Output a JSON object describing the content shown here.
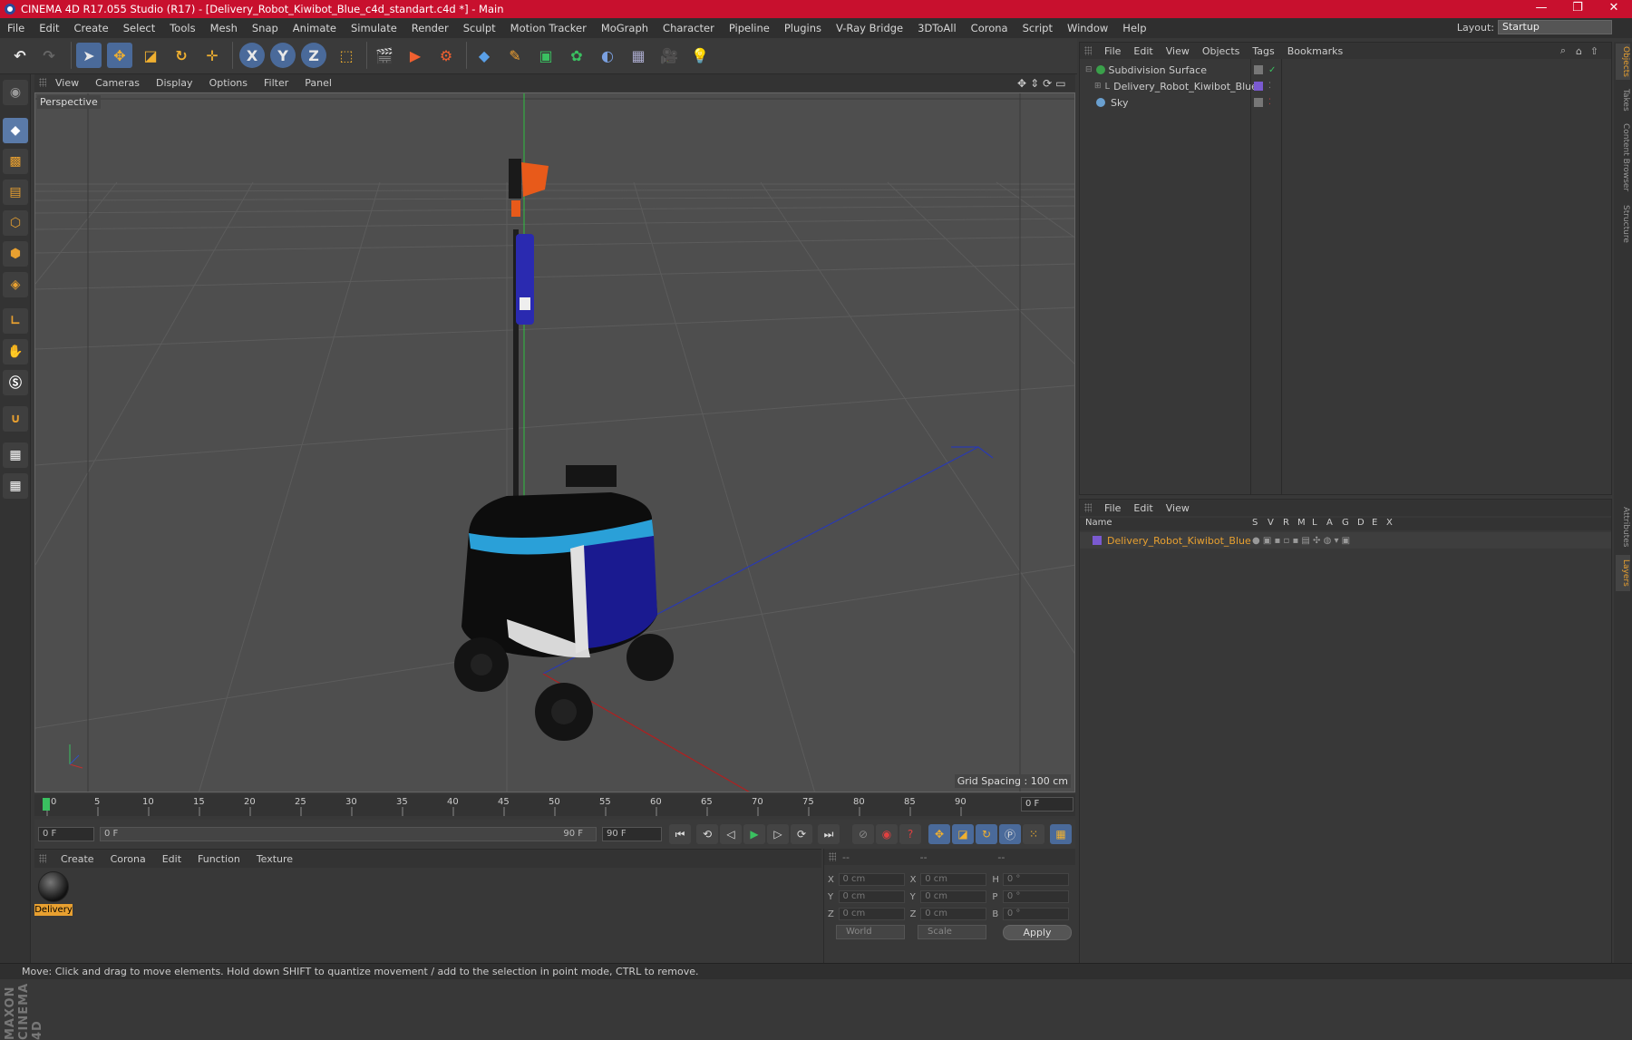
{
  "window": {
    "title": "CINEMA 4D R17.055 Studio (R17) - [Delivery_Robot_Kiwibot_Blue_c4d_standart.c4d *] - Main",
    "controls": [
      "—",
      "❐",
      "✕"
    ]
  },
  "menu": [
    "File",
    "Edit",
    "Create",
    "Select",
    "Tools",
    "Mesh",
    "Snap",
    "Animate",
    "Simulate",
    "Render",
    "Sculpt",
    "Motion Tracker",
    "MoGraph",
    "Character",
    "Pipeline",
    "Plugins",
    "V-Ray Bridge",
    "3DToAll",
    "Corona",
    "Script",
    "Window",
    "Help"
  ],
  "layout": {
    "label": "Layout:",
    "value": "Startup"
  },
  "toolbar": {
    "axis_x": "X",
    "axis_y": "Y",
    "axis_z": "Z"
  },
  "viewport": {
    "menu": [
      "View",
      "Cameras",
      "Display",
      "Options",
      "Filter",
      "Panel"
    ],
    "label": "Perspective",
    "grid_spacing": "Grid Spacing : 100 cm"
  },
  "timeline": {
    "ticks": [
      "0",
      "5",
      "10",
      "15",
      "20",
      "25",
      "30",
      "35",
      "40",
      "45",
      "50",
      "55",
      "60",
      "65",
      "70",
      "75",
      "80",
      "85",
      "90"
    ],
    "current_frame": "0 F"
  },
  "playbar": {
    "start": "0 F",
    "range_start": "0 F",
    "range_end": "90 F",
    "end": "90 F"
  },
  "material_manager": {
    "menu": [
      "Create",
      "Corona",
      "Edit",
      "Function",
      "Texture"
    ],
    "material_name": "Delivery"
  },
  "coordinates": {
    "header": [
      "--",
      "--",
      "--"
    ],
    "rows": [
      {
        "a1": "X",
        "v1": "0 cm",
        "a2": "X",
        "v2": "0 cm",
        "a3": "H",
        "v3": "0 °"
      },
      {
        "a1": "Y",
        "v1": "0 cm",
        "a2": "Y",
        "v2": "0 cm",
        "a3": "P",
        "v3": "0 °"
      },
      {
        "a1": "Z",
        "v1": "0 cm",
        "a2": "Z",
        "v2": "0 cm",
        "a3": "B",
        "v3": "0 °"
      }
    ],
    "mode": "World",
    "transform": "Scale",
    "apply": "Apply"
  },
  "object_manager": {
    "menu": [
      "File",
      "Edit",
      "View",
      "Objects",
      "Tags",
      "Bookmarks"
    ],
    "objects": [
      {
        "name": "Subdivision Surface",
        "color": "#3aa04a"
      },
      {
        "name": "Delivery_Robot_Kiwibot_Blue",
        "color": "#7a5ad0"
      },
      {
        "name": "Sky",
        "color": "#6aa0d0"
      }
    ]
  },
  "layer_manager": {
    "menu": [
      "File",
      "Edit",
      "View"
    ],
    "columns": [
      "Name",
      "S",
      "V",
      "R",
      "M",
      "L",
      "A",
      "G",
      "D",
      "E",
      "X"
    ],
    "layers": [
      {
        "name": "Delivery_Robot_Kiwibot_Blue",
        "color": "#7a5ad0"
      }
    ]
  },
  "right_tabs": [
    "Objects",
    "Takes",
    "Content Browser",
    "Structure",
    "Attributes",
    "Layers"
  ],
  "status": "Move: Click and drag to move elements. Hold down SHIFT to quantize movement / add to the selection in point mode, CTRL to remove.",
  "branding": "MAXON CINEMA 4D",
  "colors": {
    "title_bar": "#c8102e",
    "accent": "#e8a030",
    "selection_blue": "#4a6a9a"
  }
}
